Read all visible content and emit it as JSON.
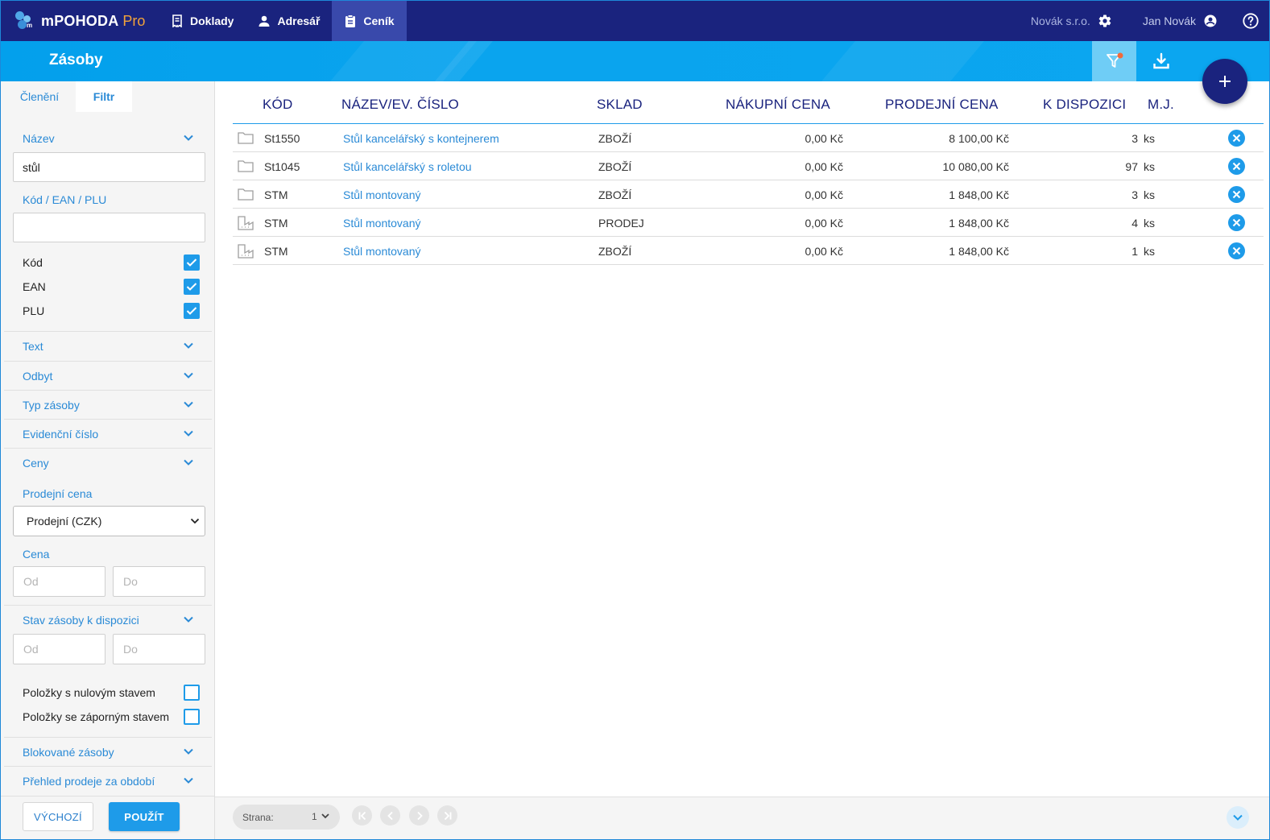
{
  "app": {
    "name": "mPOHODA",
    "edition": "Pro",
    "nav": [
      {
        "label": "Doklady",
        "icon": "receipt-icon"
      },
      {
        "label": "Adresář",
        "icon": "person-icon"
      },
      {
        "label": "Ceník",
        "icon": "clipboard-icon"
      }
    ],
    "company": "Novák s.r.o.",
    "user": "Jan Novák"
  },
  "page": {
    "title": "Zásoby"
  },
  "sidebar": {
    "tabs": [
      "Členění",
      "Filtr"
    ],
    "active_tab": "Filtr",
    "name_section": "Název",
    "name_value": "stůl",
    "code_label": "Kód / EAN / PLU",
    "code_value": "",
    "checkboxes": [
      {
        "label": "Kód",
        "checked": true
      },
      {
        "label": "EAN",
        "checked": true
      },
      {
        "label": "PLU",
        "checked": true
      }
    ],
    "sections": [
      "Text",
      "Odbyt",
      "Typ zásoby",
      "Evidenční číslo",
      "Ceny"
    ],
    "price_label": "Prodejní cena",
    "price_select": "Prodejní (CZK)",
    "cena_label": "Cena",
    "from_placeholder": "Od",
    "to_placeholder": "Do",
    "stock_section": "Stav zásoby k dispozici",
    "zero_label": "Položky s nulovým stavem",
    "negative_label": "Položky se záporným stavem",
    "zero_checked": false,
    "negative_checked": false,
    "blocked_section": "Blokované zásoby",
    "sales_section": "Přehled prodeje za období",
    "default_button": "VÝCHOZÍ",
    "apply_button": "POUŽÍT"
  },
  "table": {
    "columns": [
      "KÓD",
      "NÁZEV/EV. ČÍSLO",
      "SKLAD",
      "NÁKUPNÍ CENA",
      "PRODEJNÍ CENA",
      "K DISPOZICI",
      "M.J."
    ],
    "rows": [
      {
        "icon": "folder-icon",
        "code": "St1550",
        "name": "Stůl kancelářský s kontejnerem",
        "store": "ZBOŽÍ",
        "buy": "0,00 Kč",
        "sell": "8 100,00 Kč",
        "qty": "3",
        "unit": "ks"
      },
      {
        "icon": "folder-icon",
        "code": "St1045",
        "name": "Stůl kancelářský s roletou",
        "store": "ZBOŽÍ",
        "buy": "0,00 Kč",
        "sell": "10 080,00 Kč",
        "qty": "97",
        "unit": "ks"
      },
      {
        "icon": "folder-icon",
        "code": "STM",
        "name": "Stůl montovaný",
        "store": "ZBOŽÍ",
        "buy": "0,00 Kč",
        "sell": "1 848,00 Kč",
        "qty": "3",
        "unit": "ks"
      },
      {
        "icon": "factory-icon",
        "code": "STM",
        "name": "Stůl montovaný",
        "store": "PRODEJ",
        "buy": "0,00 Kč",
        "sell": "1 848,00 Kč",
        "qty": "4",
        "unit": "ks"
      },
      {
        "icon": "factory-icon",
        "code": "STM",
        "name": "Stůl montovaný",
        "store": "ZBOŽÍ",
        "buy": "0,00 Kč",
        "sell": "1 848,00 Kč",
        "qty": "1",
        "unit": "ks"
      }
    ]
  },
  "pager": {
    "label": "Strana:",
    "page": "1"
  },
  "colors": {
    "navy": "#1a237e",
    "accent": "#1e9be9",
    "header_bar": "#03a0ec",
    "link": "#2a8ad6",
    "pro_orange": "#f2a33a"
  }
}
